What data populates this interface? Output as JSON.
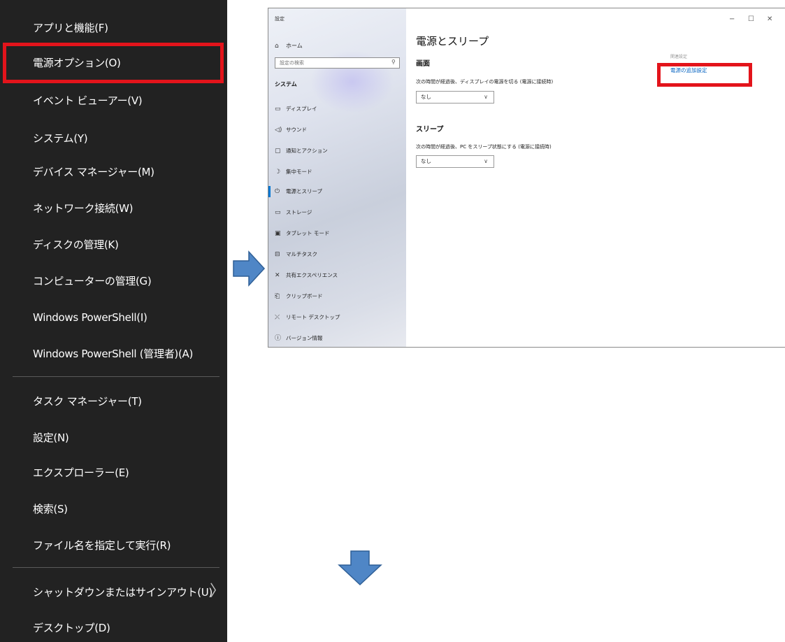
{
  "winx_menu": {
    "items": [
      "アプリと機能(F)",
      "電源オプション(O)",
      "イベント ビューアー(V)",
      "システム(Y)",
      "デバイス マネージャー(M)",
      "ネットワーク接続(W)",
      "ディスクの管理(K)",
      "コンピューターの管理(G)",
      "Windows PowerShell(I)",
      "Windows PowerShell (管理者)(A)",
      "タスク マネージャー(T)",
      "設定(N)",
      "エクスプローラー(E)",
      "検索(S)",
      "ファイル名を指定して実行(R)",
      "シャットダウンまたはサインアウト(U)",
      "デスクトップ(D)"
    ],
    "highlighted_item": "電源オプション(O)",
    "submenu_chevron": "〉"
  },
  "settings_window": {
    "title": "設定",
    "controls": {
      "minimize": "−",
      "maximize": "☐",
      "close": "✕"
    },
    "sidebar": {
      "home": "ホーム",
      "search_placeholder": "設定の検索",
      "section": "システム",
      "items": [
        {
          "label": "ディスプレイ",
          "icon": "display-icon"
        },
        {
          "label": "サウンド",
          "icon": "sound-icon"
        },
        {
          "label": "通知とアクション",
          "icon": "notification-icon"
        },
        {
          "label": "集中モード",
          "icon": "focus-icon"
        },
        {
          "label": "電源とスリープ",
          "icon": "power-icon"
        },
        {
          "label": "ストレージ",
          "icon": "storage-icon"
        },
        {
          "label": "タブレット モード",
          "icon": "tablet-icon"
        },
        {
          "label": "マルチタスク",
          "icon": "multitask-icon"
        },
        {
          "label": "共有エクスペリエンス",
          "icon": "shared-icon"
        },
        {
          "label": "クリップボード",
          "icon": "clipboard-icon"
        },
        {
          "label": "リモート デスクトップ",
          "icon": "remote-icon"
        },
        {
          "label": "バージョン情報",
          "icon": "info-icon"
        }
      ],
      "active_item": "電源とスリープ"
    },
    "main": {
      "title": "電源とスリープ",
      "screen_heading": "画面",
      "screen_desc": "次の時間が経過後、ディスプレイの電源を切る (電源に接続時)",
      "screen_value": "なし",
      "sleep_heading": "スリープ",
      "sleep_desc": "次の時間が経過後、PC をスリープ状態にする (電源に接続時)",
      "sleep_value": "なし",
      "related_label": "関連設定",
      "power_link": "電源の追加設定"
    }
  },
  "colors": {
    "highlight_box": "#e3141b",
    "arrow": "#4f86c6",
    "menu_bg": "#222222",
    "accent": "#0078d4"
  }
}
